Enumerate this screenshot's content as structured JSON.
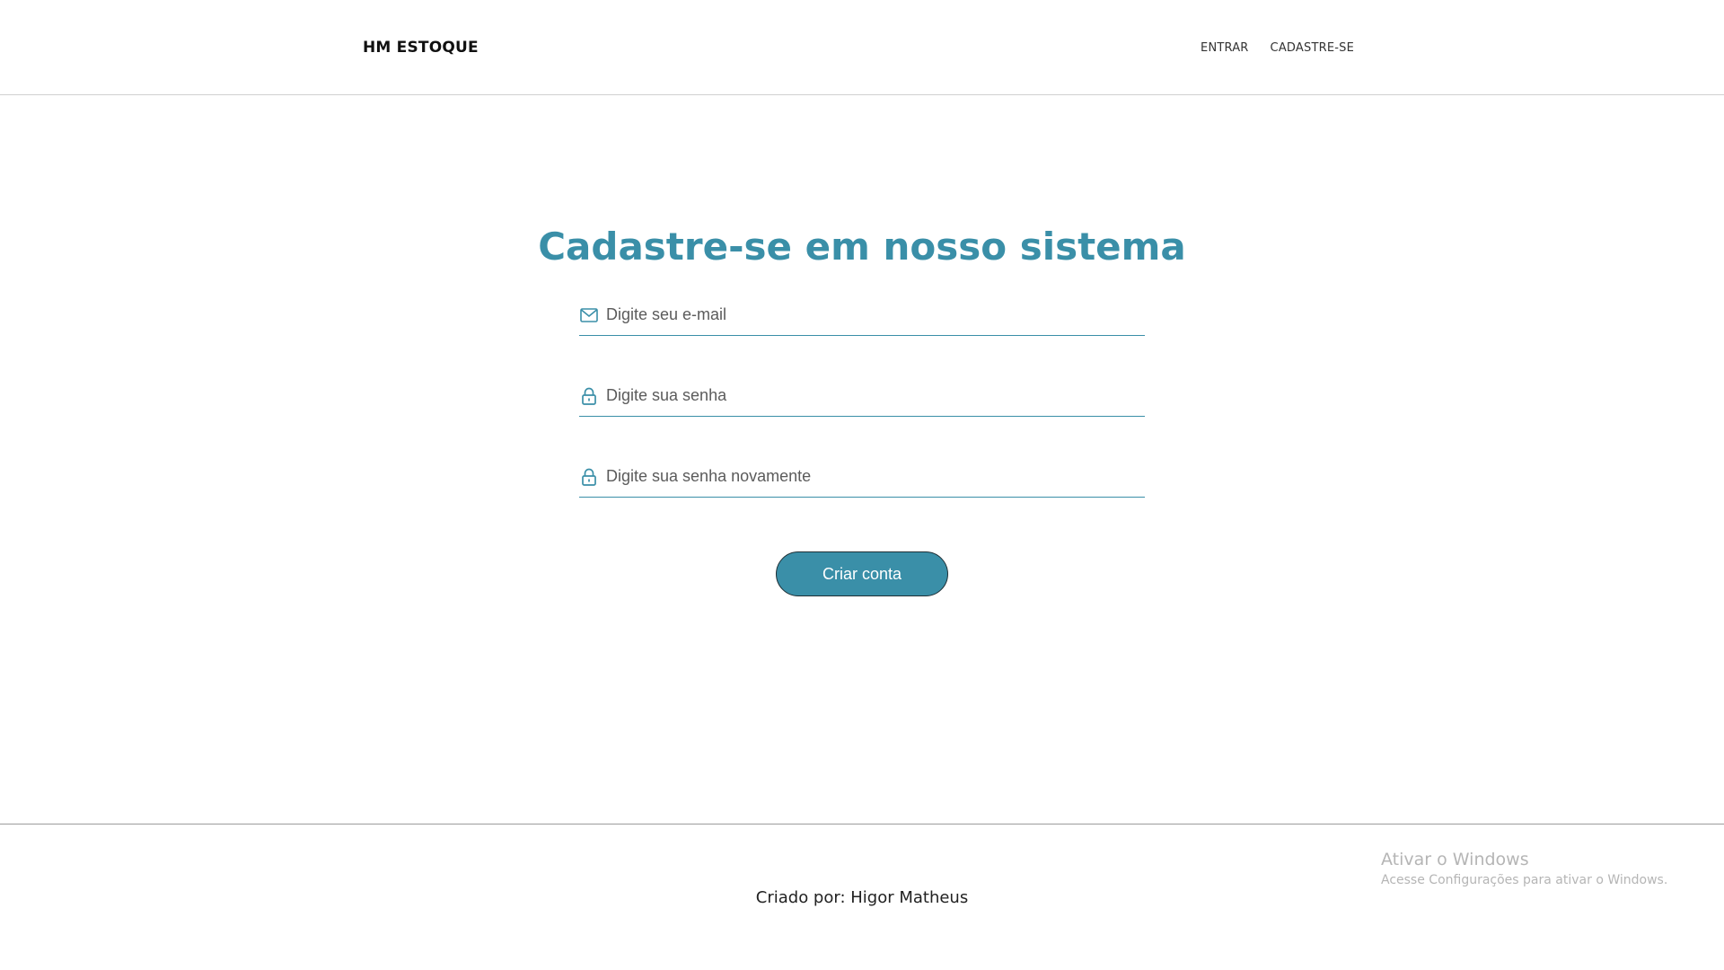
{
  "header": {
    "brand": "HM ESTOQUE",
    "nav": [
      {
        "label": "ENTRAR"
      },
      {
        "label": "CADASTRE-SE"
      }
    ]
  },
  "main": {
    "title": "Cadastre-se em nosso sistema",
    "fields": {
      "email": {
        "placeholder": "Digite seu e-mail",
        "icon": "envelope-icon"
      },
      "password": {
        "placeholder": "Digite sua senha",
        "icon": "lock-icon"
      },
      "password_confirm": {
        "placeholder": "Digite sua senha novamente",
        "icon": "lock-icon"
      }
    },
    "submit_label": "Criar conta"
  },
  "footer": {
    "credit": "Criado por: Higor Matheus"
  },
  "os_watermark": {
    "title": "Ativar o Windows",
    "subtitle": "Acesse Configurações para ativar o Windows."
  },
  "colors": {
    "accent": "#3a8fa8",
    "text": "#222222",
    "background": "#ffffff"
  }
}
